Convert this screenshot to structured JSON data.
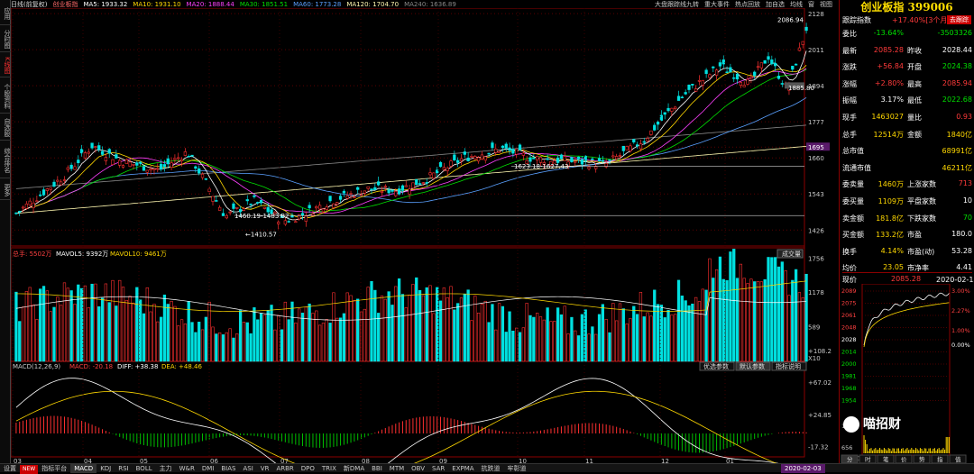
{
  "sidebar": {
    "tabs": [
      "应用",
      "分时图",
      "K线图",
      "个股资料",
      "自选股",
      "综合排名",
      "更多"
    ]
  },
  "ma": {
    "label": "日线(前复权)",
    "items": [
      {
        "name": "创业板指",
        "color": "#ff6a6a"
      },
      {
        "text": "MA5: 1933.32",
        "color": "#ffffff"
      },
      {
        "text": "MA10: 1931.10",
        "color": "#ffd800"
      },
      {
        "text": "MA20: 1888.44",
        "color": "#ff40ff"
      },
      {
        "text": "MA30: 1851.51",
        "color": "#00e000"
      },
      {
        "text": "MA60: 1773.28",
        "color": "#5aa0ff"
      },
      {
        "text": "MA120: 1704.70",
        "color": "#fff8b0"
      },
      {
        "text": "MA240: 1636.89",
        "color": "#888888"
      }
    ]
  },
  "toptools": [
    "大盘跟踪线九转",
    "重大事件",
    "热点回放",
    "加自选",
    "均线",
    "窗",
    "视图"
  ],
  "price_axis": [
    "2128",
    "2011",
    "1894",
    "1777",
    "1695",
    "1660",
    "1543",
    "1426"
  ],
  "price_labels": {
    "high": "2086.94",
    "low": "1410.57",
    "mark1": "1460.19-1483.82",
    "mark2": "1623.18-1627.43",
    "mark3": "1885.80"
  },
  "vol": {
    "header": "总手: 5502万",
    "mavol5": "MAVOL5: 9392万",
    "mavol10": "MAVOL10: 9461万",
    "axis": [
      "1756",
      "1178",
      "589",
      "X10"
    ],
    "btn": "成交量"
  },
  "macd": {
    "header": "MACD(12,26,9)",
    "macd_val": "MACD: -20.18",
    "diff": "DIFF: +38.38",
    "dea": "DEA: +48.46",
    "axis": [
      "+108.2",
      "+67.02",
      "+24.85",
      "-17.32"
    ],
    "btns": [
      "优选参数",
      "默认参数",
      "指标说明"
    ]
  },
  "months": [
    "03",
    "04",
    "05",
    "06",
    "07",
    "08",
    "09",
    "10",
    "11",
    "12",
    "01"
  ],
  "datebox": "2020-02-03",
  "bottom_tabs": [
    "设置",
    "NEW",
    "指标平台",
    "MACD",
    "KDJ",
    "RSI",
    "BOLL",
    "主力",
    "W&R",
    "DMI",
    "BIAS",
    "ASI",
    "VR",
    "ARBR",
    "DPO",
    "TRIX",
    "新DMA",
    "BBI",
    "MTM",
    "OBV",
    "SAR",
    "EXPMA",
    "抗跌道",
    "牢彰道"
  ],
  "right": {
    "title": "创业板指 399006",
    "track_label": "跟踪指数",
    "track_value": "+17.40%[3个月]",
    "track_btn": "去跟踪",
    "rows": [
      [
        {
          "t": "委比",
          "c": "wht"
        },
        {
          "t": "-13.64%",
          "c": "grn"
        },
        {
          "t": "",
          "c": ""
        },
        {
          "t": "-3503326",
          "c": "grn"
        }
      ],
      [
        {
          "t": "最新",
          "c": "wht"
        },
        {
          "t": "2085.28",
          "c": "red"
        },
        {
          "t": "昨收",
          "c": "wht"
        },
        {
          "t": "2028.44",
          "c": "wht"
        }
      ],
      [
        {
          "t": "涨跌",
          "c": "wht"
        },
        {
          "t": "+56.84",
          "c": "red"
        },
        {
          "t": "开盘",
          "c": "wht"
        },
        {
          "t": "2024.38",
          "c": "grn"
        }
      ],
      [
        {
          "t": "涨幅",
          "c": "wht"
        },
        {
          "t": "+2.80%",
          "c": "red"
        },
        {
          "t": "最高",
          "c": "wht"
        },
        {
          "t": "2085.94",
          "c": "red"
        }
      ],
      [
        {
          "t": "振幅",
          "c": "wht"
        },
        {
          "t": "3.17%",
          "c": "wht"
        },
        {
          "t": "最低",
          "c": "wht"
        },
        {
          "t": "2022.68",
          "c": "grn"
        }
      ],
      [
        {
          "t": "现手",
          "c": "wht"
        },
        {
          "t": "1463027",
          "c": "yel"
        },
        {
          "t": "量比",
          "c": "wht"
        },
        {
          "t": "0.93",
          "c": "red"
        }
      ],
      [
        {
          "t": "总手",
          "c": "wht"
        },
        {
          "t": "12514万",
          "c": "yel"
        },
        {
          "t": "金额",
          "c": "wht"
        },
        {
          "t": "1840亿",
          "c": "yel"
        }
      ],
      [
        {
          "t": "总市值",
          "c": "wht"
        },
        {
          "t": "",
          "c": ""
        },
        {
          "t": "",
          "c": ""
        },
        {
          "t": "68991亿",
          "c": "yel"
        }
      ],
      [
        {
          "t": "流通市值",
          "c": "wht"
        },
        {
          "t": "",
          "c": ""
        },
        {
          "t": "",
          "c": ""
        },
        {
          "t": "46211亿",
          "c": "yel"
        }
      ],
      [
        {
          "t": "委卖量",
          "c": "wht"
        },
        {
          "t": "1460万",
          "c": "yel"
        },
        {
          "t": "上涨家数",
          "c": "wht"
        },
        {
          "t": "713",
          "c": "red"
        }
      ],
      [
        {
          "t": "委买量",
          "c": "wht"
        },
        {
          "t": "1109万",
          "c": "yel"
        },
        {
          "t": "平盘家数",
          "c": "wht"
        },
        {
          "t": "10",
          "c": "wht"
        }
      ],
      [
        {
          "t": "卖金额",
          "c": "wht"
        },
        {
          "t": "181.8亿",
          "c": "yel"
        },
        {
          "t": "下跌家数",
          "c": "wht"
        },
        {
          "t": "70",
          "c": "grn"
        }
      ],
      [
        {
          "t": "买金额",
          "c": "wht"
        },
        {
          "t": "133.2亿",
          "c": "yel"
        },
        {
          "t": "市盈",
          "c": "wht"
        },
        {
          "t": "180.0",
          "c": "wht"
        }
      ],
      [
        {
          "t": "换手",
          "c": "wht"
        },
        {
          "t": "4.14%",
          "c": "yel"
        },
        {
          "t": "市盈(动)",
          "c": "wht"
        },
        {
          "t": "53.28",
          "c": "wht"
        }
      ],
      [
        {
          "t": "均价",
          "c": "wht"
        },
        {
          "t": "23.05",
          "c": "yel"
        },
        {
          "t": "市净率",
          "c": "wht"
        },
        {
          "t": "4.41",
          "c": "wht"
        }
      ]
    ],
    "xianjia_label": "现价",
    "xianjia_value": "2085.28",
    "xianjia_date": "2020-02-12 三",
    "mini_axis_left": [
      "2089",
      "2075",
      "2061",
      "2048",
      "2028",
      "2014",
      "2000",
      "1981",
      "1968",
      "1954"
    ],
    "mini_axis_right": [
      "3.00%",
      "2.27%",
      "1.00%",
      "0.00%"
    ],
    "mini_vol": [
      "1966",
      "656",
      "X10000"
    ],
    "bottom_tabs": [
      "分",
      "时",
      "笔",
      "价",
      "势",
      "指",
      "值"
    ],
    "watermark": "喵招财"
  },
  "colors": {
    "up": "#ff3030",
    "down": "#00e0e0",
    "ma5": "#ffffff",
    "ma10": "#ffd800",
    "ma20": "#ff40ff",
    "ma30": "#00e000",
    "ma60": "#5aa0ff",
    "ma120": "#fff8b0",
    "ma240": "#888888"
  }
}
